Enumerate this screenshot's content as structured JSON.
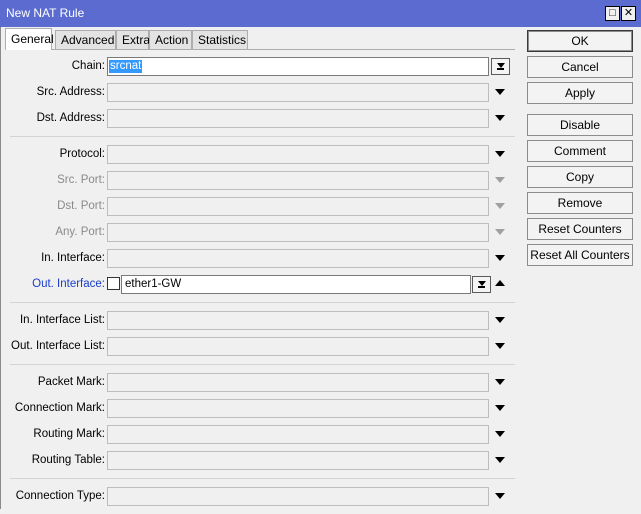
{
  "window": {
    "title": "New NAT Rule",
    "restore_glyph": "□",
    "close_glyph": "✕"
  },
  "tabs": [
    "General",
    "Advanced",
    "Extra",
    "Action",
    "Statistics"
  ],
  "fields": {
    "chain": {
      "label": "Chain:",
      "value": "srcnat"
    },
    "src_address": {
      "label": "Src. Address:"
    },
    "dst_address": {
      "label": "Dst. Address:"
    },
    "protocol": {
      "label": "Protocol:"
    },
    "src_port": {
      "label": "Src. Port:"
    },
    "dst_port": {
      "label": "Dst. Port:"
    },
    "any_port": {
      "label": "Any. Port:"
    },
    "in_interface": {
      "label": "In. Interface:"
    },
    "out_interface": {
      "label": "Out. Interface:",
      "value": "ether1-GW"
    },
    "in_interface_list": {
      "label": "In. Interface List:"
    },
    "out_interface_list": {
      "label": "Out. Interface List:"
    },
    "packet_mark": {
      "label": "Packet Mark:"
    },
    "connection_mark": {
      "label": "Connection Mark:"
    },
    "routing_mark": {
      "label": "Routing Mark:"
    },
    "routing_table": {
      "label": "Routing Table:"
    },
    "connection_type": {
      "label": "Connection Type:"
    }
  },
  "buttons": {
    "ok": "OK",
    "cancel": "Cancel",
    "apply": "Apply",
    "disable": "Disable",
    "comment": "Comment",
    "copy": "Copy",
    "remove": "Remove",
    "reset_counters": "Reset Counters",
    "reset_all_counters": "Reset All Counters"
  },
  "colors": {
    "titlebar": "#5b6bd0",
    "active_label": "#1a3cc8",
    "selection": "#3399ff"
  }
}
